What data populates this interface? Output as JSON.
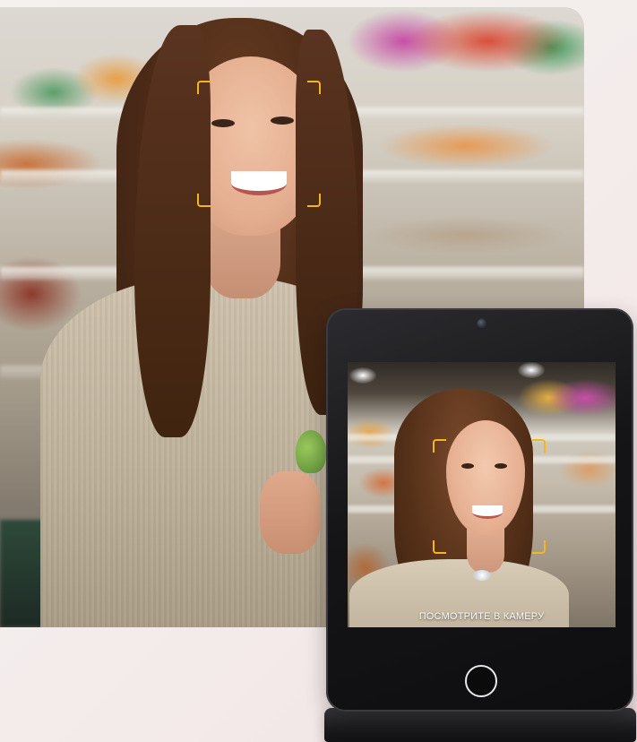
{
  "tablet": {
    "screen_prompt": "ПОСМОТРИТЕ В КАМЕРУ"
  },
  "colors": {
    "focus_frame": "#f5b51d",
    "tablet_body": "#151517",
    "home_button_ring": "#e8e8ea"
  },
  "icons": {
    "front_camera": "camera-lens-icon",
    "home_button": "home-button-icon"
  }
}
